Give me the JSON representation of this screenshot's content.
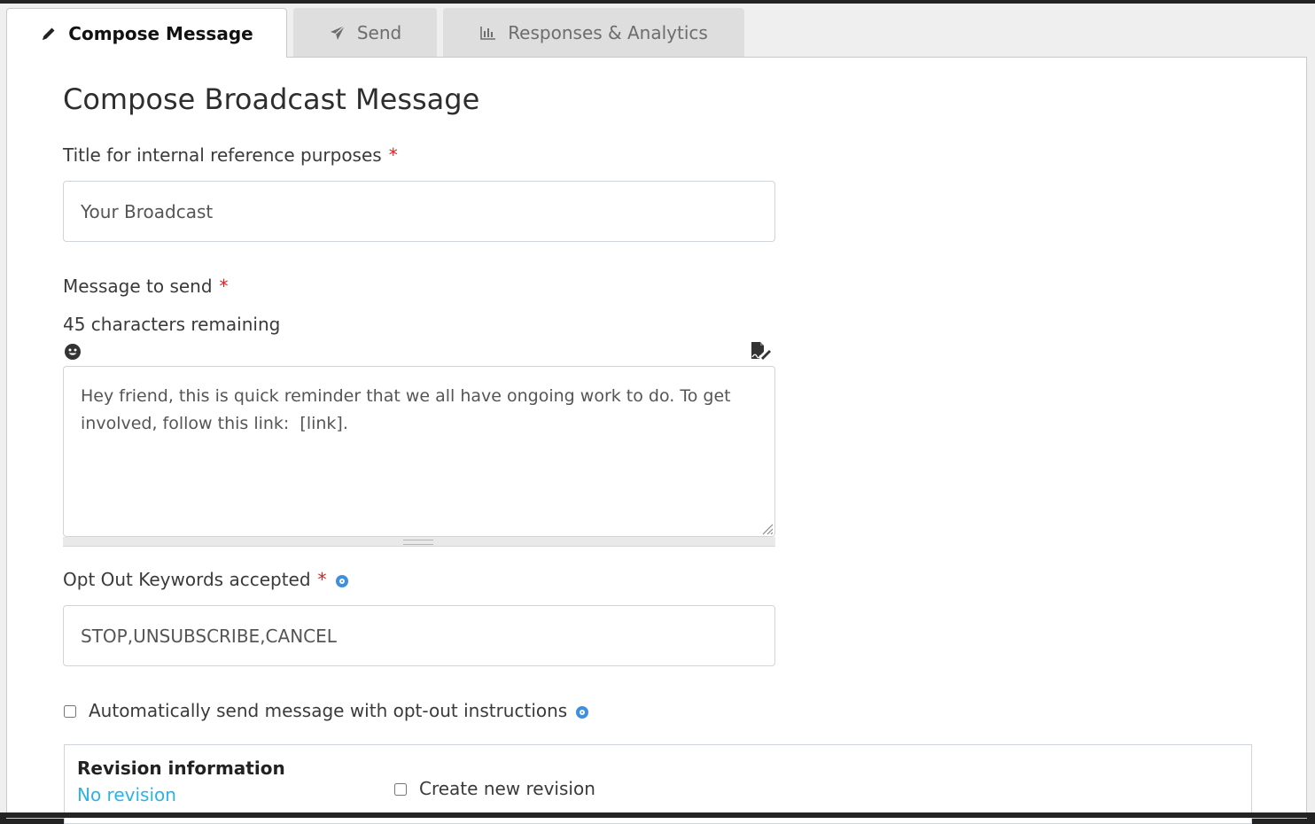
{
  "tabs": [
    {
      "label": "Compose Message",
      "icon": "pencil-icon",
      "active": true
    },
    {
      "label": "Send",
      "icon": "paper-plane-icon",
      "active": false
    },
    {
      "label": "Responses & Analytics",
      "icon": "bar-chart-icon",
      "active": false
    }
  ],
  "page": {
    "heading": "Compose Broadcast Message"
  },
  "title_field": {
    "label": "Title for internal reference purposes",
    "required_mark": "*",
    "value": "Your Broadcast"
  },
  "message_field": {
    "label": "Message to send",
    "required_mark": "*",
    "remaining": "45 characters remaining",
    "value": "Hey friend, this is quick reminder that we all have ongoing work to do. To get involved, follow this link:  [link]."
  },
  "optout_field": {
    "label": "Opt Out Keywords accepted",
    "required_mark": "*",
    "value": "STOP,UNSUBSCRIBE,CANCEL"
  },
  "auto_optout": {
    "label": "Automatically send message with opt-out instructions",
    "checked": false
  },
  "revision": {
    "title": "Revision information",
    "status": "No revision",
    "new_revision_label": "Create new revision",
    "new_revision_checked": false
  },
  "colors": {
    "required": "#e02020",
    "link": "#2bb3e6",
    "info": "#3d8fe0"
  }
}
